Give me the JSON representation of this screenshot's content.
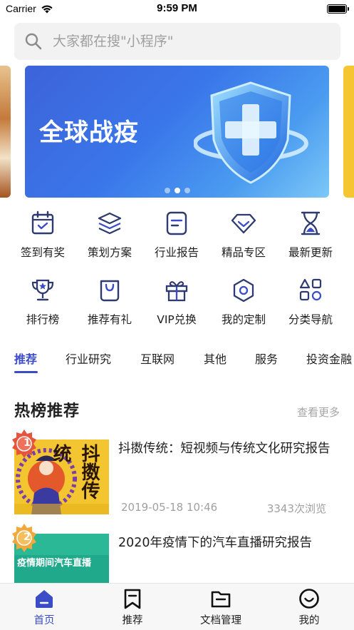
{
  "status_bar": {
    "carrier": "Carrier",
    "time": "9:59 PM"
  },
  "search": {
    "placeholder": "大家都在搜\"小程序\""
  },
  "banner": {
    "title": "全球战疫",
    "slides": 3,
    "active_slide": 2
  },
  "grid": [
    {
      "label": "签到有奖",
      "icon": "calendar-check-icon"
    },
    {
      "label": "策划方案",
      "icon": "layers-icon"
    },
    {
      "label": "行业报告",
      "icon": "document-icon"
    },
    {
      "label": "精品专区",
      "icon": "diamond-icon"
    },
    {
      "label": "最新更新",
      "icon": "hourglass-icon"
    },
    {
      "label": "排行榜",
      "icon": "trophy-icon"
    },
    {
      "label": "推荐有礼",
      "icon": "shopping-bag-icon"
    },
    {
      "label": "VIP兑换",
      "icon": "gift-icon"
    },
    {
      "label": "我的定制",
      "icon": "hexagon-icon"
    },
    {
      "label": "分类导航",
      "icon": "category-shapes-icon"
    }
  ],
  "tabs": [
    {
      "label": "推荐",
      "active": true
    },
    {
      "label": "行业研究"
    },
    {
      "label": "互联网"
    },
    {
      "label": "其他"
    },
    {
      "label": "服务"
    },
    {
      "label": "投资金融"
    }
  ],
  "section": {
    "title": "热榜推荐",
    "more": "查看更多"
  },
  "articles": [
    {
      "rank": "1",
      "title": "抖擞传统：短视频与传统文化研究报告",
      "date": "2019-05-18 10:46",
      "views": "3343次浏览",
      "thumb_text": "抖擞传统"
    },
    {
      "rank": "2",
      "title": "2020年疫情下的汽车直播研究报告",
      "thumb_text": "疫情期间汽车直播"
    }
  ],
  "bottom_nav": [
    {
      "label": "首页",
      "icon": "home-icon",
      "active": true
    },
    {
      "label": "推荐",
      "icon": "bookmark-icon"
    },
    {
      "label": "文档管理",
      "icon": "folder-icon"
    },
    {
      "label": "我的",
      "icon": "smiley-icon"
    }
  ],
  "colors": {
    "accent": "#3b4cc7",
    "icon_stroke": "#2f3a6e",
    "muted": "#a0a0a0"
  }
}
